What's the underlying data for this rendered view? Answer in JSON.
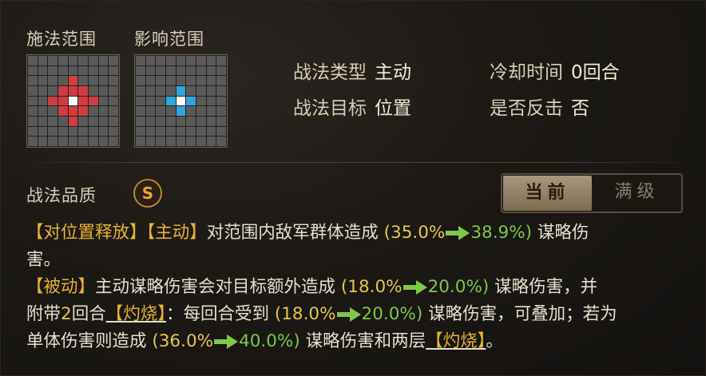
{
  "range": {
    "cast_label": "施法范围",
    "effect_label": "影响范围",
    "cast_grid": [
      "000000000",
      "000000000",
      "0000R0000",
      "000RRR000",
      "00RRWRR00",
      "000RRR000",
      "0000R0000",
      "000000000",
      "000000000"
    ],
    "effect_grid": [
      "000000000",
      "000000000",
      "000000000",
      "0000B0000",
      "000BWB000",
      "0000B0000",
      "000000000",
      "000000000",
      "000000000"
    ]
  },
  "info": {
    "type_label": "战法类型",
    "type_value": "主动",
    "cooldown_label": "冷却时间",
    "cooldown_value": "0回合",
    "target_label": "战法目标",
    "target_value": "位置",
    "counter_label": "是否反击",
    "counter_value": "否"
  },
  "quality": {
    "label": "战法品质",
    "grade": "S"
  },
  "toggle": {
    "current": "当前",
    "max": "满级"
  },
  "desc": {
    "l1_tag1": "【对位置释放】",
    "l1_tag2": "【主动】",
    "l1_text": "对范围内敌军群体造成",
    "v1_from": "(35.0%",
    "v1_to": "38.9%)",
    "l1_end": "谋略伤",
    "l2": "害。",
    "l3_tag": "【被动】",
    "l3_text": "主动谋略伤害会对目标额外造成",
    "v2_from": "(18.0%",
    "v2_to": "20.0%)",
    "l3_end": "谋略伤害，并",
    "l4_a": "附带",
    "l4_num": "2",
    "l4_b": "回合",
    "l4_burn": "【灼烧】",
    "l4_c": "：每回合受到",
    "v3_from": "(18.0%",
    "v3_to": "20.0%)",
    "l4_end": "谋略伤害，可叠加；若为",
    "l5_a": "单体伤害则造成",
    "v4_from": "(36.0%",
    "v4_to": "40.0%)",
    "l5_b": "谋略伤害和两层",
    "l5_burn": "【灼烧】",
    "l5_end": "。"
  },
  "colors": {
    "tag": "#e8b233",
    "from": "#e5c84d",
    "to": "#7ec84a",
    "red": "#d13c3f",
    "blue": "#2fa6dc"
  }
}
